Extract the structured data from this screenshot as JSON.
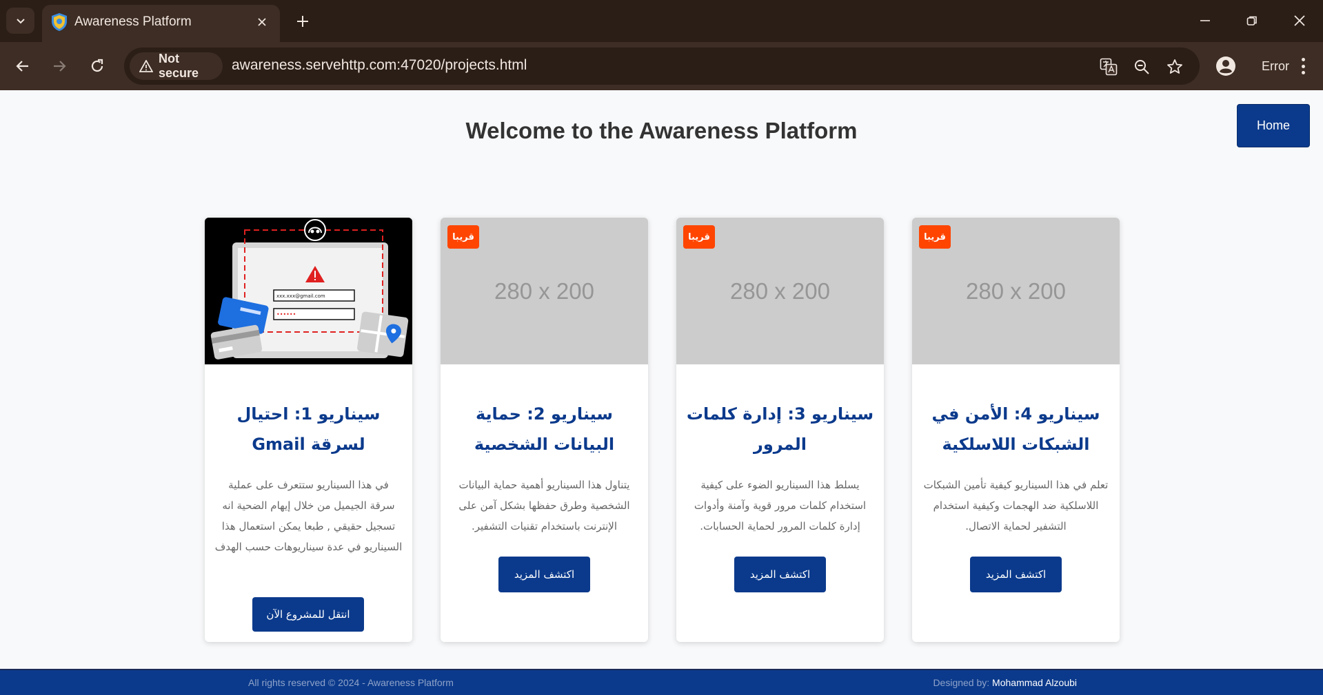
{
  "browser": {
    "tab_title": "Awareness Platform",
    "security_label": "Not secure",
    "url": "awareness.servehttp.com:47020/projects.html",
    "profile_status": "Error"
  },
  "page": {
    "title": "Welcome to the Awareness Platform",
    "home_label": "Home"
  },
  "cards": [
    {
      "title": "سيناريو 1: احتيال لسرقة Gmail",
      "description": "في هذا السيناريو ستتعرف على عملية سرقة الجيميل من خلال إيهام الضحية انه تسجيل حقيقي , طبعا يمكن استعمال هذا السيناريو في عدة سيناريوهات حسب الهدف",
      "button": "انتقل للمشروع الآن"
    },
    {
      "badge": "قريبا",
      "placeholder": "280 x 200",
      "title": "سيناريو 2: حماية البيانات الشخصية",
      "description": "يتناول هذا السيناريو أهمية حماية البيانات الشخصية وطرق حفظها بشكل آمن على الإنترنت باستخدام تقنيات التشفير.",
      "button": "اكتشف المزيد"
    },
    {
      "badge": "قريبا",
      "placeholder": "280 x 200",
      "title": "سيناريو 3: إدارة كلمات المرور",
      "description": "يسلط هذا السيناريو الضوء على كيفية استخدام كلمات مرور قوية وآمنة وأدوات إدارة كلمات المرور لحماية الحسابات.",
      "button": "اكتشف المزيد"
    },
    {
      "badge": "قريبا",
      "placeholder": "280 x 200",
      "title": "سيناريو 4: الأمن في الشبكات اللاسلكية",
      "description": "تعلم في هذا السيناريو كيفية تأمين الشبكات اللاسلكية ضد الهجمات وكيفية استخدام التشفير لحماية الاتصال.",
      "button": "اكتشف المزيد"
    }
  ],
  "phishing_illustration": {
    "email_text": "xxx.xxx@gmail.com",
    "password_text": "••••••"
  },
  "footer": {
    "copyright": "All rights reserved © 2024 - Awareness Platform",
    "designed_by_label": "Designed by:",
    "designer_name": "Mohammad Alzoubi"
  },
  "colors": {
    "primary": "#0b3a8c",
    "badge": "#ff4500",
    "chrome_dark": "#2b1e17",
    "chrome": "#3d2d24"
  }
}
